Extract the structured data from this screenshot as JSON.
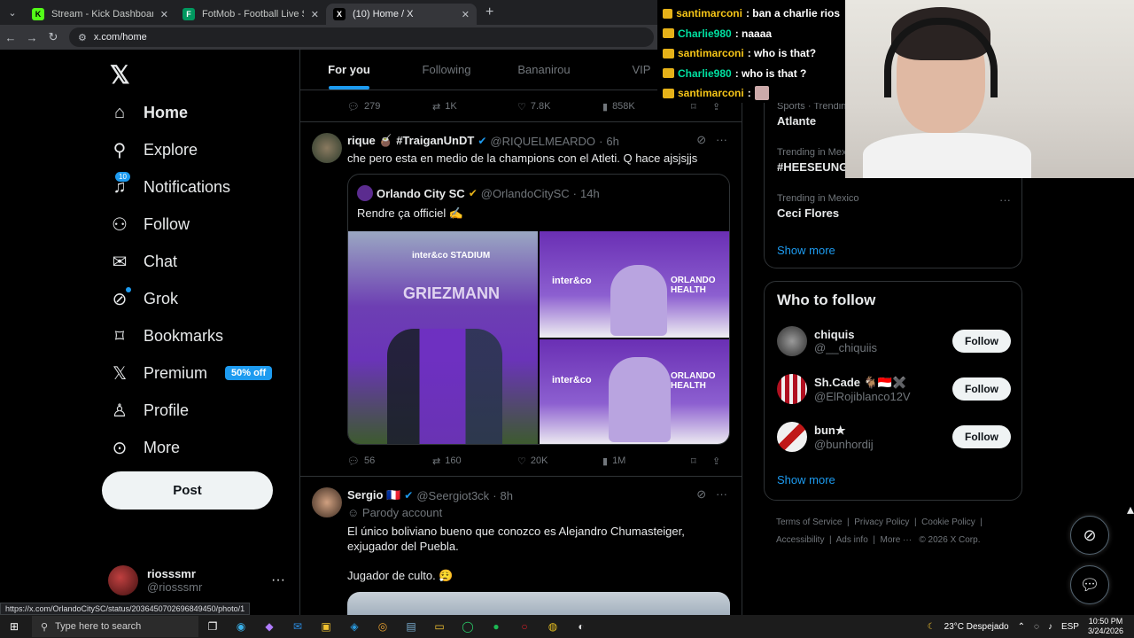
{
  "browser": {
    "tabs": [
      {
        "title": "Stream - Kick Dashboard",
        "favicon": "K",
        "color": "#53fc18"
      },
      {
        "title": "FotMob - Football Live Scores",
        "favicon": "F",
        "color": "#00985f"
      },
      {
        "title": "(10) Home / X",
        "favicon": "X",
        "color": "#000000"
      }
    ],
    "url": "x.com/home",
    "status_url": "https://x.com/OrlandoCitySC/status/2036450702696849450/photo/1"
  },
  "nav": {
    "items": [
      {
        "label": "Home",
        "icon": "home-icon"
      },
      {
        "label": "Explore",
        "icon": "search-icon"
      },
      {
        "label": "Notifications",
        "icon": "bell-icon",
        "badge": "10"
      },
      {
        "label": "Follow",
        "icon": "person-add-icon"
      },
      {
        "label": "Chat",
        "icon": "mail-icon"
      },
      {
        "label": "Grok",
        "icon": "grok-icon"
      },
      {
        "label": "Bookmarks",
        "icon": "bookmark-icon"
      },
      {
        "label": "Premium",
        "icon": "x-icon",
        "badge": "50% off"
      },
      {
        "label": "Profile",
        "icon": "profile-icon"
      },
      {
        "label": "More",
        "icon": "more-circle-icon"
      }
    ],
    "post_label": "Post",
    "account": {
      "name": "riosssmr",
      "handle": "@riosssmr"
    }
  },
  "timeline": {
    "tabs": [
      "For you",
      "Following",
      "Bananirou",
      "VIP"
    ],
    "top_actions": {
      "replies": "279",
      "reposts": "1K",
      "likes": "7.8K",
      "views": "858K"
    },
    "post1": {
      "name": "rique 🧉 #TraiganUnDT",
      "handle": "@RIQUELMEARDO",
      "time": "6h",
      "text": "che pero esta en medio de la champions con el Atleti. Q hace ajsjsjjs",
      "quote": {
        "name": "Orlando City SC",
        "handle": "@OrlandoCitySC",
        "time": "14h",
        "text": "Rendre ça officiel ✍️",
        "image_texts": {
          "board_brand": "inter&co STADIUM",
          "board_name": "GRIEZMANN",
          "sponsor": "inter&co",
          "sponsor2": "ORLANDO HEALTH"
        }
      },
      "actions": {
        "replies": "56",
        "reposts": "160",
        "likes": "20K",
        "views": "1M"
      }
    },
    "post2": {
      "name": "Sergio 🇫🇷",
      "handle": "@Seergiot3ck",
      "time": "8h",
      "label": "Parody account",
      "text1": "El único boliviano bueno que conozco es Alejandro Chumasteiger, exjugador del Puebla.",
      "text2": "Jugador de culto. 😮‍💨"
    }
  },
  "sidebar": {
    "trends": [
      {
        "category": "Sports · Trending",
        "title": "Atlante"
      },
      {
        "category": "Trending in Mexico",
        "title": "#HEESEUNG"
      },
      {
        "category": "Trending in Mexico",
        "title": "Ceci Flores"
      }
    ],
    "show_more": "Show more",
    "who_to_follow_title": "Who to follow",
    "follow_label": "Follow",
    "suggestions": [
      {
        "name": "chiquis",
        "handle": "@__chiquiis"
      },
      {
        "name": "Sh.Cade 🐐🇮🇩✖️",
        "handle": "@ElRojiblanco12V"
      },
      {
        "name": "bun★",
        "handle": "@bunhordij"
      }
    ],
    "show_more2": "Show more",
    "footer": [
      "Terms of Service",
      "Privacy Policy",
      "Cookie Policy",
      "Accessibility",
      "Ads info",
      "More ···",
      "© 2026 X Corp."
    ]
  },
  "chat_overlay": [
    {
      "user": "santimarconi",
      "msg": ": ban a charlie rios",
      "color": "#f5c518"
    },
    {
      "user": "Charlie980",
      "msg": ": naaaa",
      "color": "#00e0a0"
    },
    {
      "user": "santimarconi",
      "msg": ": who is that?",
      "color": "#f5c518"
    },
    {
      "user": "Charlie980",
      "msg": ": who is that ?",
      "color": "#00e0a0"
    },
    {
      "user": "santimarconi",
      "msg": ":",
      "color": "#f5c518"
    }
  ],
  "taskbar": {
    "search_placeholder": "Type here to search",
    "weather": "23°C Despejado",
    "lang": "ESP",
    "time": "10:50 PM",
    "date": "3/24/2026"
  }
}
